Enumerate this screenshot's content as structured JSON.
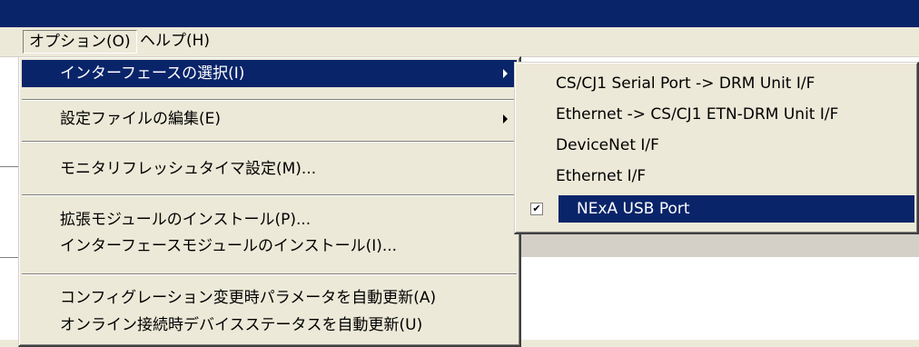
{
  "menubar": {
    "options_label": "オプション(O)",
    "help_label": "ヘルプ(H)"
  },
  "options_menu": {
    "items": [
      {
        "label": "インターフェースの選択(I)",
        "has_submenu": true
      },
      {
        "label": "設定ファイルの編集(E)",
        "has_submenu": true
      },
      {
        "label": "モニタリフレッシュタイマ設定(M)..."
      },
      {
        "label": "拡張モジュールのインストール(P)..."
      },
      {
        "label": "インターフェースモジュールのインストール(I)..."
      },
      {
        "label": "コンフィグレーション変更時パラメータを自動更新(A)"
      },
      {
        "label": "オンライン接続時デバイスステータスを自動更新(U)"
      }
    ]
  },
  "interface_submenu": {
    "items": [
      {
        "label": "CS/CJ1 Serial Port -> DRM Unit I/F"
      },
      {
        "label": "Ethernet -> CS/CJ1 ETN-DRM Unit I/F"
      },
      {
        "label": "DeviceNet I/F"
      },
      {
        "label": "Ethernet I/F"
      },
      {
        "label": "NExA USB Port",
        "checked": true
      }
    ],
    "check_mark": "✔"
  },
  "colors": {
    "highlight": "#0a246a",
    "menu_bg": "#ece9d8"
  }
}
